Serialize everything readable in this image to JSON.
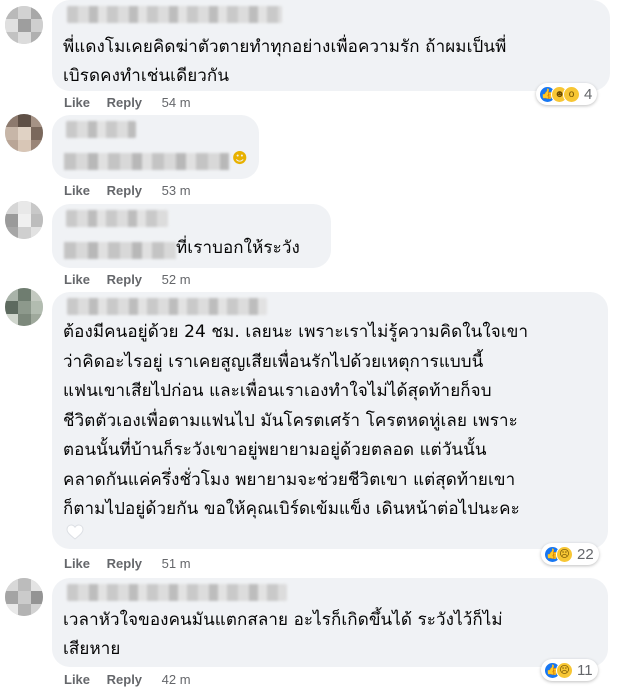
{
  "actions": {
    "like": "Like",
    "reply": "Reply"
  },
  "comments": [
    {
      "lines": [
        "พี่แดงโมเคยคิดฆ่าตัวตายทำทุกอย่างเพื่อความรัก ถ้าผมเป็นพี่",
        "เบิรดคงทำเช่นเดียวกัน"
      ],
      "time": "54 m",
      "reactions": {
        "icons": [
          "like-icon",
          "haha-icon",
          "wow-icon"
        ],
        "count": "4"
      }
    },
    {
      "lines": [],
      "time": "53 m"
    },
    {
      "lines": [
        "ที่เราบอกให้ระวัง"
      ],
      "time": "52 m"
    },
    {
      "lines": [
        "ต้องมีคนอยู่ด้วย 24 ชม. เลยนะ เพราะเราไม่รู้ความคิดในใจเขา",
        "ว่าคิดอะไรอยู่ เราเคยสูญเสียเพื่อนรักไปด้วยเหตุการแบบนี้",
        "แฟนเขาเสียไปก่อน และเพื่อนเราเองทำใจไม่ได้สุดท้ายก็จบ",
        "ชีวิตตัวเองเพื่อตามแฟนไป มันโครตเศร้า โครตหดหู่เลย เพราะ",
        "ตอนนั้นที่บ้านก็ระวังเขาอยู่พยายามอยู่ด้วยตลอด แต่วันนั้น",
        "คลาดกันแค่ครึ่งชั่วโมง พยายามจะช่วยชีวิตเขา แต่สุดท้ายเขา",
        "ก็ตามไปอยู่ด้วยกัน ขอให้คุณเบิร์ดเข้มแข็ง เดินหน้าต่อไปนะคะ"
      ],
      "time": "51 m",
      "reactions": {
        "icons": [
          "like-icon",
          "sad-icon"
        ],
        "count": "22"
      }
    },
    {
      "lines": [
        "เวลาหัวใจของคนมันแตกสลาย อะไรก็เกิดขึ้นได้ ระวังไว้ก็ไม่",
        "เสียหาย"
      ],
      "time": "42 m",
      "reactions": {
        "icons": [
          "like-icon",
          "sad-icon"
        ],
        "count": "11"
      }
    }
  ]
}
